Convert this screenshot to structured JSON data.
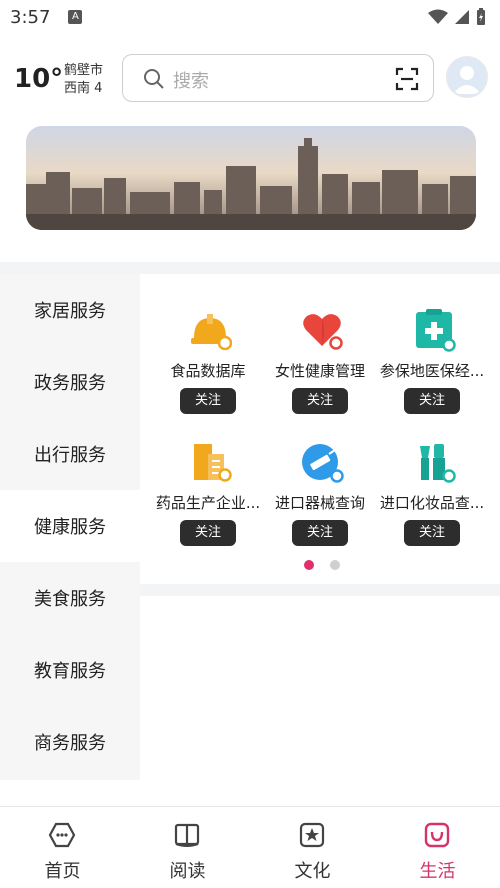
{
  "status": {
    "time": "3:57",
    "notif": "A"
  },
  "weather": {
    "temp": "10°",
    "city": "鹤壁市",
    "wind": "西南 4"
  },
  "search": {
    "placeholder": "搜索"
  },
  "categories": [
    {
      "label": "家居服务"
    },
    {
      "label": "政务服务"
    },
    {
      "label": "出行服务"
    },
    {
      "label": "健康服务"
    },
    {
      "label": "美食服务"
    },
    {
      "label": "教育服务"
    },
    {
      "label": "商务服务"
    }
  ],
  "active_category": "健康服务",
  "services": [
    {
      "name": "食品数据库",
      "follow": "关注",
      "icon": "hardhat-icon",
      "color": "#f2a81d"
    },
    {
      "name": "女性健康管理",
      "follow": "关注",
      "icon": "heart-icon",
      "color": "#e8453c"
    },
    {
      "name": "参保地医保经...",
      "follow": "关注",
      "icon": "clipboard-plus-icon",
      "color": "#1fb7a6"
    },
    {
      "name": "药品生产企业...",
      "follow": "关注",
      "icon": "building-icon",
      "color": "#f2a81d"
    },
    {
      "name": "进口器械查询",
      "follow": "关注",
      "icon": "syringe-icon",
      "color": "#2f9be8"
    },
    {
      "name": "进口化妆品查...",
      "follow": "关注",
      "icon": "cosmetics-icon",
      "color": "#1fb7a6"
    }
  ],
  "pager": {
    "pages": 2,
    "current": 1
  },
  "nav": [
    {
      "label": "首页",
      "icon": "home-icon"
    },
    {
      "label": "阅读",
      "icon": "book-icon"
    },
    {
      "label": "文化",
      "icon": "star-box-icon"
    },
    {
      "label": "生活",
      "icon": "bag-icon"
    }
  ],
  "colors": {
    "accent": "#d6336c",
    "button": "#2d2d2d"
  }
}
